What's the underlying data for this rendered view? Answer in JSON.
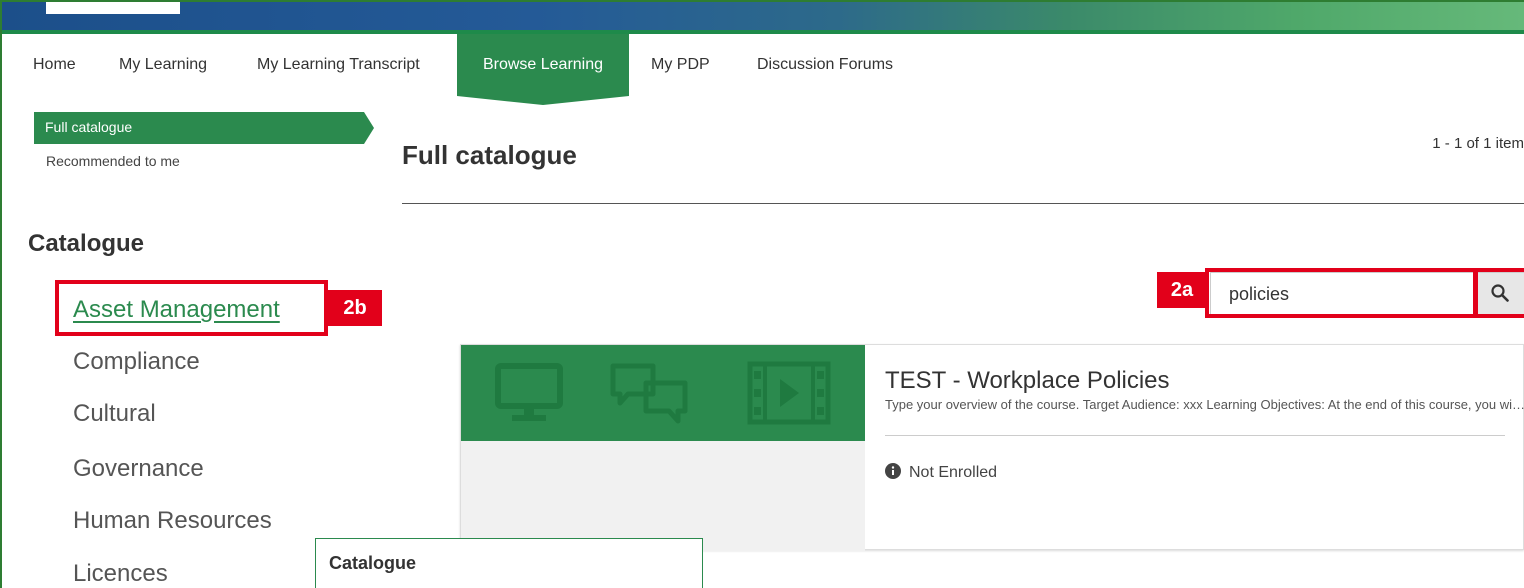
{
  "nav": {
    "items": [
      {
        "label": "Home"
      },
      {
        "label": "My Learning"
      },
      {
        "label": "My Learning Transcript"
      },
      {
        "label": "Browse Learning"
      },
      {
        "label": "My PDP"
      },
      {
        "label": "Discussion Forums"
      }
    ],
    "active": "Browse Learning"
  },
  "sidebar": {
    "full_catalogue": "Full catalogue",
    "recommended": "Recommended to me",
    "heading": "Catalogue",
    "categories": [
      {
        "label": "Asset Management"
      },
      {
        "label": "Compliance"
      },
      {
        "label": "Cultural"
      },
      {
        "label": "Governance"
      },
      {
        "label": "Human Resources"
      },
      {
        "label": "Licences"
      }
    ]
  },
  "main": {
    "title": "Full catalogue",
    "count": "1 - 1 of 1 item",
    "search": {
      "value": "policies"
    }
  },
  "annotations": {
    "tag_2a": "2a",
    "tag_2b": "2b"
  },
  "course": {
    "title": "TEST - Workplace Policies",
    "description": "Type your overview of the course. Target Audience: xxx Learning Objectives: At the end of this course, you will be able to:",
    "status": "Not Enrolled"
  },
  "popup": {
    "label": "Catalogue"
  },
  "colors": {
    "brand_green": "#2b8a4e",
    "highlight_red": "#e2001a",
    "banner_blue": "#1c4f8a"
  }
}
